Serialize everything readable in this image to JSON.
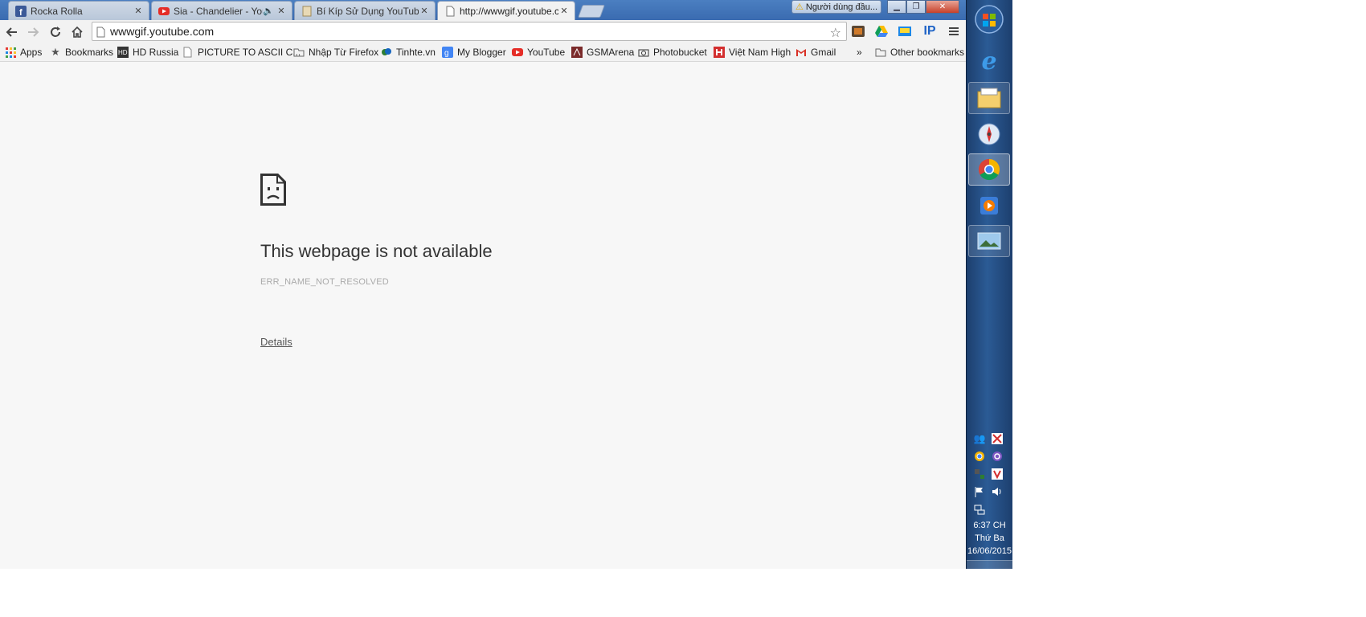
{
  "tabs": [
    {
      "title": "Rocka Rolla",
      "icon": "facebook-icon"
    },
    {
      "title": "Sia - Chandelier - YouT",
      "icon": "youtube-icon"
    },
    {
      "title": "Bí Kíp Sử Dụng YouTube |",
      "icon": "document-icon"
    },
    {
      "title": "http://wwwgif.youtube.co",
      "icon": "page-icon"
    }
  ],
  "window": {
    "warning_label": "Người dùng đầu..."
  },
  "toolbar": {
    "url": "wwwgif.youtube.com"
  },
  "bookmarks": {
    "items": [
      {
        "label": "Apps",
        "icon": "apps-grid-icon"
      },
      {
        "label": "Bookmarks",
        "icon": "star-icon"
      },
      {
        "label": "HD Russia",
        "icon": "hd-icon"
      },
      {
        "label": "PICTURE TO ASCII C...",
        "icon": "page-icon"
      },
      {
        "label": "Nhập Từ Firefox",
        "icon": "folder-icon"
      },
      {
        "label": "Tinhte.vn",
        "icon": "tinhte-icon"
      },
      {
        "label": "My Blogger",
        "icon": "blogger-icon"
      },
      {
        "label": "YouTube",
        "icon": "youtube-icon"
      },
      {
        "label": "GSMArena",
        "icon": "gsmarena-icon"
      },
      {
        "label": "Photobucket",
        "icon": "camera-icon"
      },
      {
        "label": "Việt Nam High",
        "icon": "vnhigh-icon"
      },
      {
        "label": "Gmail",
        "icon": "gmail-icon"
      }
    ],
    "overflow": "»",
    "other": "Other bookmarks"
  },
  "error": {
    "title": "This webpage is not available",
    "code": "ERR_NAME_NOT_RESOLVED",
    "details": "Details"
  },
  "taskbar": {
    "clock_time": "6:37 CH",
    "clock_day": "Thứ Ba",
    "clock_date": "16/06/2015"
  },
  "colors": {
    "page_bg": "#f7f7f7",
    "tabstrip": "#3a6bb0",
    "taskbar": "#1d3f6e"
  }
}
